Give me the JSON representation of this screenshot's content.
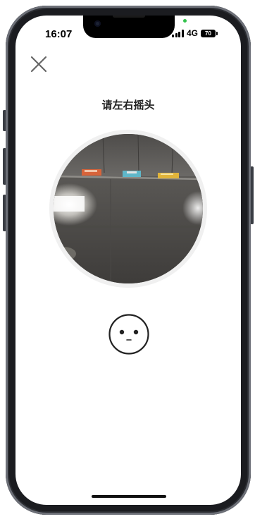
{
  "status_bar": {
    "time": "16:07",
    "network": "4G",
    "battery_level": "70",
    "signal_bars": 4,
    "recording_indicator_color": "#33c24d"
  },
  "header": {
    "close_icon": "close-icon"
  },
  "instruction": {
    "text": "请左右摇头"
  },
  "camera": {
    "ring_color": "#f0f0f0"
  },
  "face_guide": {
    "icon": "face-icon"
  }
}
